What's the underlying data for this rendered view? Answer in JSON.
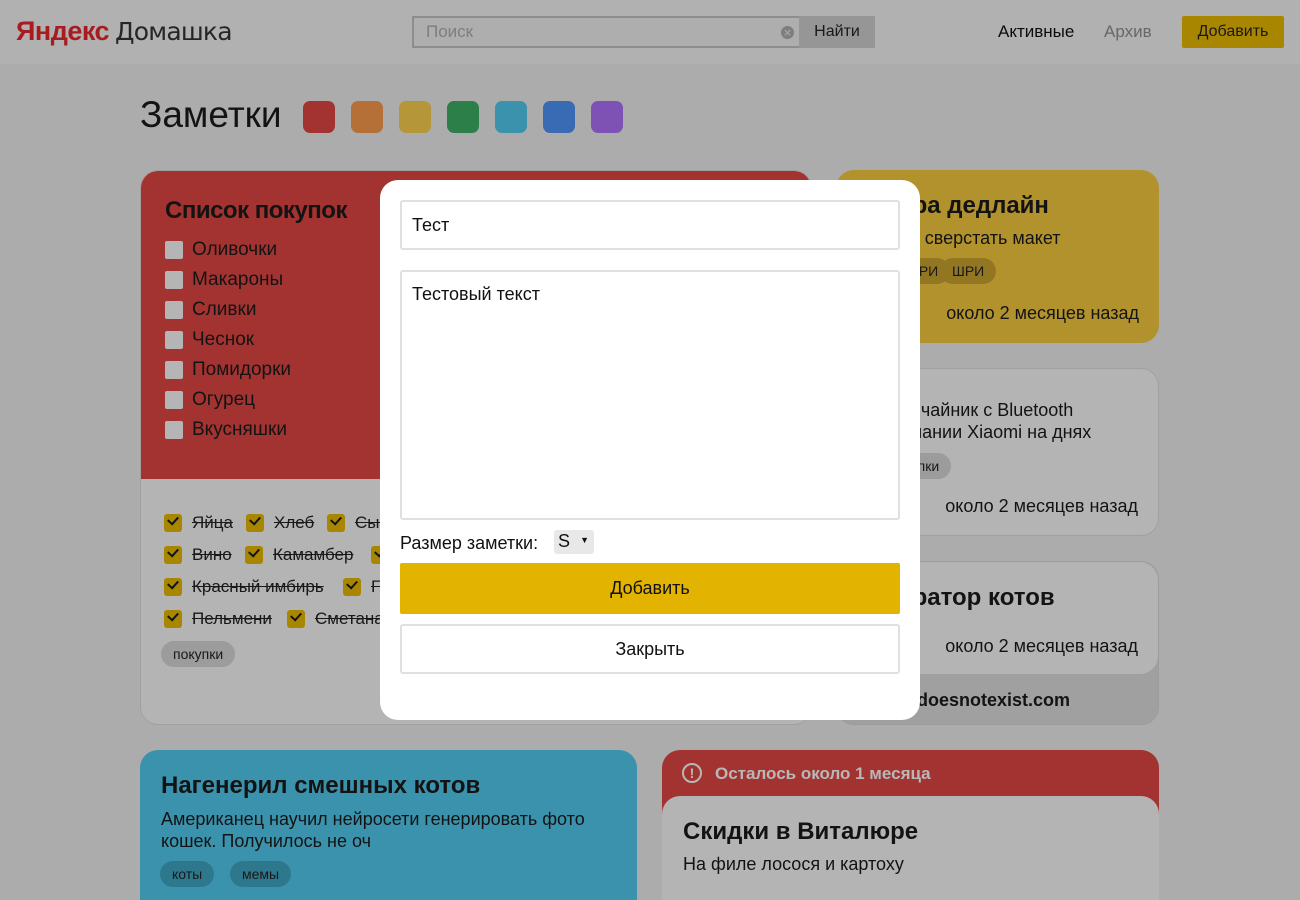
{
  "header": {
    "logo_brand": "Яндекс",
    "logo_product": "Домашка",
    "search_placeholder": "Поиск",
    "search_button": "Найти",
    "nav_active": "Активные",
    "nav_archive": "Архив",
    "add_button": "Добавить"
  },
  "page": {
    "title": "Заметки",
    "colors": [
      "#da4442",
      "#f1964a",
      "#f2c94c",
      "#3daa62",
      "#4ec3e6",
      "#4c8ef0",
      "#a86df0"
    ]
  },
  "shopping": {
    "title": "Список покупок",
    "todo": [
      "Оливочки",
      "Макароны",
      "Сливки",
      "Чеснок",
      "Помидорки",
      "Огурец",
      "Вкусняшки"
    ],
    "done_rows": [
      [
        "Яйца",
        "Хлеб",
        "Сыр"
      ],
      [
        "Вино",
        "Камамбер",
        "В"
      ],
      [
        "Красный имбирь",
        "Г"
      ],
      [
        "Пельмени",
        "Сметана"
      ]
    ],
    "tag": "покупки"
  },
  "deadline": {
    "title": "Завтра дедлайн",
    "text": "Забыть сверстать макет",
    "tags": [
      "ШРИ",
      "ШРИ"
    ],
    "time": "около 2 месяцев назад"
  },
  "kettle": {
    "text_line1": "Купить чайник с Bluetooth",
    "text_line2": "от компании Xiaomi на днях",
    "tag": "покупки",
    "time": "около 2 месяцев назад"
  },
  "cats": {
    "title": "Генератор котов",
    "time": "около 2 месяцев назад",
    "link": "thiscatdoesnotexist.com"
  },
  "funny": {
    "title": "Нагенерил смешных котов",
    "text": "Американец научил нейросети генерировать фото кошек. Получилось не оч",
    "tags": [
      "коты",
      "мемы"
    ]
  },
  "sale": {
    "warning": "Осталось около 1 месяца",
    "title": "Скидки в Виталюре",
    "text": "На филе лосося и картоху"
  },
  "modal": {
    "title_value": "Тест",
    "text_value": "Тестовый текст",
    "size_label": "Размер заметки:",
    "size_value": "S",
    "submit": "Добавить",
    "close": "Закрыть"
  }
}
